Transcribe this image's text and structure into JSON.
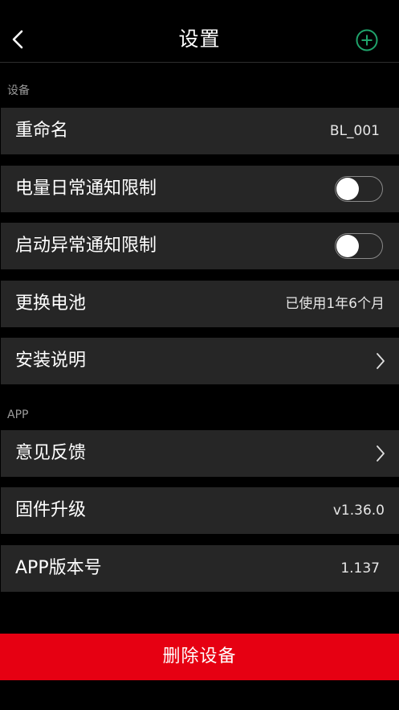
{
  "header": {
    "title": "设置",
    "back_icon": "chevron-left-icon",
    "add_icon": "plus-circle-icon",
    "accent_color": "#1fa36b"
  },
  "sections": {
    "device": {
      "label": "设备",
      "rows": [
        {
          "label": "重命名",
          "value": "BL_001"
        },
        {
          "label": "电量日常通知限制",
          "toggle_on": false
        },
        {
          "label": "启动异常通知限制",
          "toggle_on": false
        },
        {
          "label": "更换电池",
          "value": "已使用1年6个月"
        },
        {
          "label": "安装说明",
          "icon": "chevron-right-icon"
        }
      ]
    },
    "app": {
      "label": "APP",
      "rows": [
        {
          "label": "意见反馈",
          "icon": "chevron-right-icon"
        },
        {
          "label": "固件升级",
          "value": "v1.36.0"
        },
        {
          "label": "APP版本号",
          "value": "1.137"
        }
      ]
    }
  },
  "delete_button": {
    "label": "删除设备",
    "color": "#e60012"
  }
}
